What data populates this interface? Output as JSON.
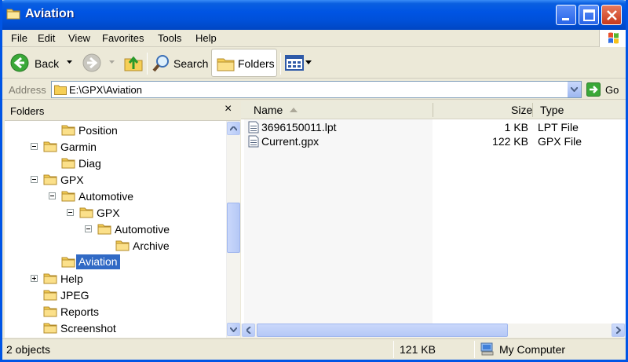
{
  "window": {
    "title": "Aviation"
  },
  "menu": [
    "File",
    "Edit",
    "View",
    "Favorites",
    "Tools",
    "Help"
  ],
  "toolbar": {
    "back_label": "Back",
    "search_label": "Search",
    "folders_label": "Folders"
  },
  "address": {
    "label": "Address",
    "path": "E:\\GPX\\Aviation",
    "go_label": "Go"
  },
  "folders_pane": {
    "title": "Folders",
    "items": [
      {
        "label": "Position",
        "indent": 4,
        "expander": "none",
        "selected": false
      },
      {
        "label": "Garmin",
        "indent": 3,
        "expander": "minus",
        "selected": false
      },
      {
        "label": "Diag",
        "indent": 4,
        "expander": "none",
        "selected": false
      },
      {
        "label": "GPX",
        "indent": 3,
        "expander": "minus",
        "selected": false
      },
      {
        "label": "Automotive",
        "indent": 4,
        "expander": "minus",
        "selected": false
      },
      {
        "label": "GPX",
        "indent": 5,
        "expander": "minus",
        "selected": false
      },
      {
        "label": "Automotive",
        "indent": 6,
        "expander": "minus",
        "selected": false
      },
      {
        "label": "Archive",
        "indent": 7,
        "expander": "none",
        "selected": false
      },
      {
        "label": "Aviation",
        "indent": 4,
        "expander": "none",
        "selected": true
      },
      {
        "label": "Help",
        "indent": 3,
        "expander": "plus",
        "selected": false
      },
      {
        "label": "JPEG",
        "indent": 3,
        "expander": "none",
        "selected": false
      },
      {
        "label": "Reports",
        "indent": 3,
        "expander": "none",
        "selected": false
      },
      {
        "label": "Screenshot",
        "indent": 3,
        "expander": "none",
        "selected": false
      }
    ]
  },
  "files": {
    "columns": [
      "Name",
      "Size",
      "Type"
    ],
    "rows": [
      {
        "name": "3696150011.lpt",
        "size": "1 KB",
        "type": "LPT File"
      },
      {
        "name": "Current.gpx",
        "size": "122 KB",
        "type": "GPX File"
      }
    ]
  },
  "status": {
    "objects": "2 objects",
    "size": "121 KB",
    "location": "My Computer"
  }
}
